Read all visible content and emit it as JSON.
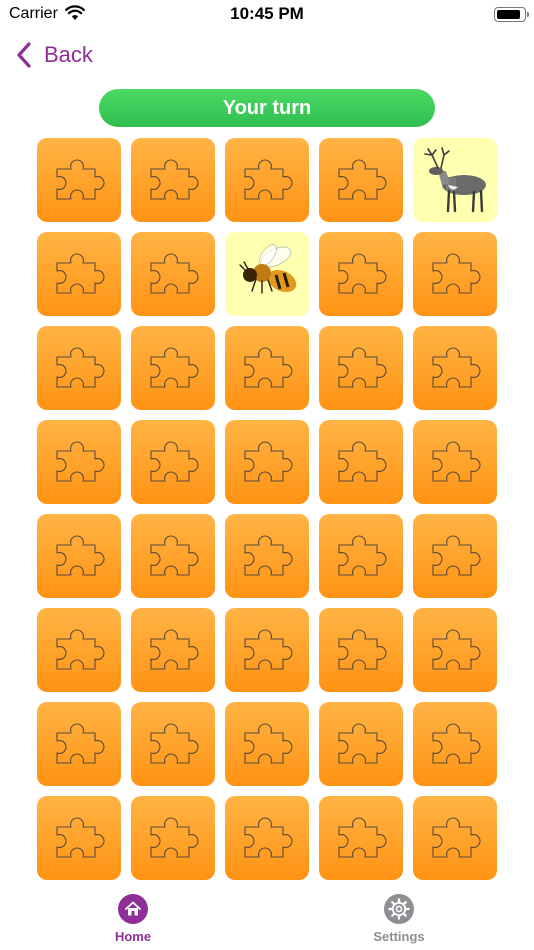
{
  "status_bar": {
    "carrier": "Carrier",
    "time": "10:45 PM"
  },
  "nav": {
    "back_label": "Back"
  },
  "banner": {
    "text": "Your turn"
  },
  "board": {
    "columns": 5,
    "rows": 8,
    "hidden_icon": "puzzle-piece-icon",
    "revealed": [
      {
        "row": 0,
        "col": 4,
        "image": "reindeer"
      },
      {
        "row": 1,
        "col": 2,
        "image": "bee"
      }
    ]
  },
  "tabs": [
    {
      "label": "Home",
      "icon": "house-icon",
      "active": true
    },
    {
      "label": "Settings",
      "icon": "gear-icon",
      "active": false
    }
  ],
  "colors": {
    "accent": "#8e2f98",
    "tile": "#ffa31f",
    "tile_revealed": "#ffffb0",
    "banner": "#36c957",
    "tab_inactive": "#8e8e93"
  }
}
